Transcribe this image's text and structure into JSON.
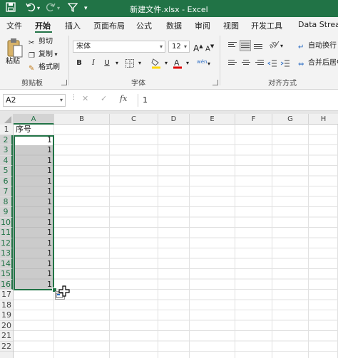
{
  "window": {
    "title": "新建文件.xlsx  -  Excel"
  },
  "tabs": [
    "文件",
    "开始",
    "插入",
    "页面布局",
    "公式",
    "数据",
    "审阅",
    "视图",
    "开发工具",
    "Data Stream"
  ],
  "active_tab": "开始",
  "ribbon": {
    "clipboard": {
      "paste": "粘贴",
      "cut": "剪切",
      "copy": "复制",
      "format_painter": "格式刷",
      "group_label": "剪贴板"
    },
    "font": {
      "font_name": "宋体",
      "font_size": "12",
      "bold": "B",
      "italic": "I",
      "underline": "U",
      "grow": "A",
      "shrink": "A",
      "phonetic": "wén",
      "group_label": "字体"
    },
    "alignment": {
      "wrap_text": "自动换行",
      "merge_center": "合并后居中",
      "group_label": "对齐方式"
    }
  },
  "formula_bar": {
    "name_box": "A2",
    "cancel": "✕",
    "enter": "✓",
    "fx": "fx",
    "value": "1"
  },
  "columns": [
    "A",
    "B",
    "C",
    "D",
    "E",
    "F",
    "G",
    "H"
  ],
  "rows": [
    "1",
    "2",
    "3",
    "4",
    "5",
    "6",
    "7",
    "8",
    "9",
    "10",
    "11",
    "12",
    "13",
    "14",
    "15",
    "16",
    "17",
    "18",
    "19",
    "20",
    "21",
    "22"
  ],
  "cells": {
    "A1": "序号",
    "A_values": [
      "1",
      "1",
      "1",
      "1",
      "1",
      "1",
      "1",
      "1",
      "1",
      "1",
      "1",
      "1",
      "1",
      "1",
      "1"
    ]
  },
  "colors": {
    "excel_green": "#217346",
    "selection_fill": "#a0a0a0"
  }
}
